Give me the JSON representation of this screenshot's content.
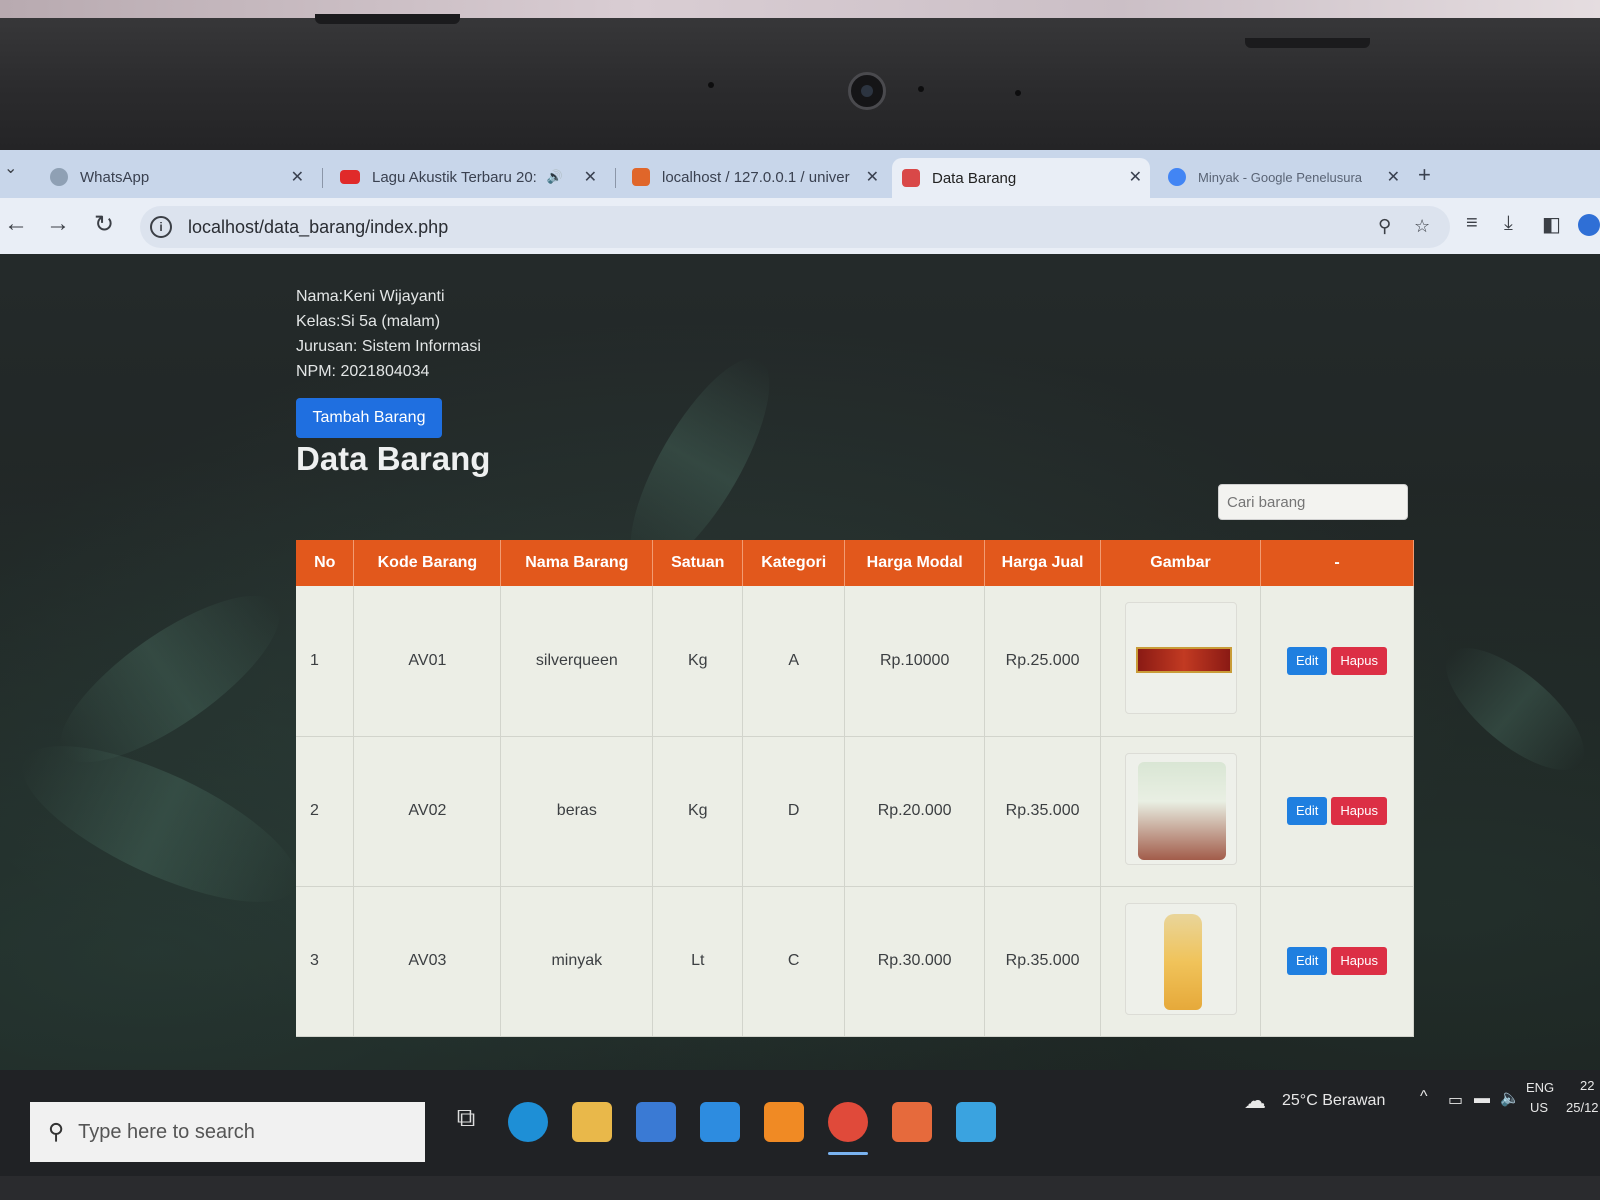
{
  "browser": {
    "tabs": [
      {
        "title": "WhatsApp",
        "color": "#25d366"
      },
      {
        "title": "Lagu Akustik Terbaru 20:",
        "color": "#e02a2a"
      },
      {
        "title": "localhost / 127.0.0.1 / univer",
        "color": "#e0662a"
      },
      {
        "title": "Data Barang",
        "color": "#d94848"
      },
      {
        "title": "Minyak - Google Penelusura",
        "color": "#4285f4"
      }
    ],
    "active_tab": 3,
    "url": "localhost/data_barang/index.php"
  },
  "student": {
    "nama": "Nama:Keni Wijayanti",
    "kelas": "Kelas:Si 5a (malam)",
    "jurusan": "Jurusan: Sistem Informasi",
    "npm": "NPM: 2021804034"
  },
  "add_button": "Tambah Barang",
  "page_title": "Data Barang",
  "search": {
    "placeholder": "Cari barang"
  },
  "table": {
    "headers": [
      "No",
      "Kode Barang",
      "Nama Barang",
      "Satuan",
      "Kategori",
      "Harga Modal",
      "Harga Jual",
      "Gambar",
      "-"
    ],
    "rows": [
      {
        "no": "1",
        "kode": "AV01",
        "nama": "silverqueen",
        "satuan": "Kg",
        "kategori": "A",
        "modal": "Rp.10000",
        "jual": "Rp.25.000",
        "image": "silverqueen-chocolate"
      },
      {
        "no": "2",
        "kode": "AV02",
        "nama": "beras",
        "satuan": "Kg",
        "kategori": "D",
        "modal": "Rp.20.000",
        "jual": "Rp.35.000",
        "image": "rice-sack"
      },
      {
        "no": "3",
        "kode": "AV03",
        "nama": "minyak",
        "satuan": "Lt",
        "kategori": "C",
        "modal": "Rp.30.000",
        "jual": "Rp.35.000",
        "image": "cooking-oil-bottle"
      }
    ],
    "edit_label": "Edit",
    "delete_label": "Hapus"
  },
  "taskbar": {
    "search_placeholder": "Type here to search",
    "weather": "25°C  Berawan",
    "lang_top": "ENG",
    "lang_bottom": "US",
    "time": "22",
    "date": "25/12"
  },
  "colors": {
    "table_header": "#e2581c",
    "primary_button": "#1f6fe0",
    "danger_button": "#dc2f45"
  }
}
